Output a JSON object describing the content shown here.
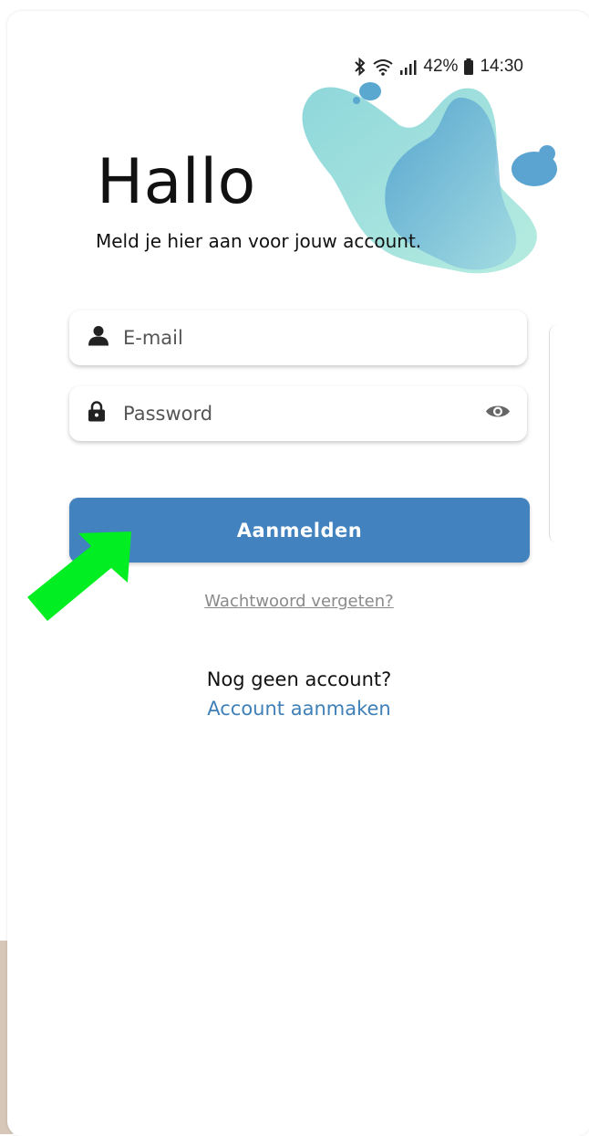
{
  "status_bar": {
    "battery": "42%",
    "time": "14:30",
    "icons": [
      "bluetooth-icon",
      "wifi-icon",
      "signal-icon",
      "battery-icon"
    ]
  },
  "header": {
    "title": "Hallo",
    "subtitle": "Meld je hier aan voor jouw account."
  },
  "form": {
    "email_placeholder": "E-mail",
    "password_placeholder": "Password",
    "submit_label": "Aanmelden"
  },
  "links": {
    "forgot_password": "Wachtwoord vergeten?",
    "no_account": "Nog geen account?",
    "create_account": "Account aanmaken"
  },
  "colors": {
    "primary": "#4282bf",
    "link": "#3f80b8",
    "annotation_arrow": "#00ee22",
    "blob_light": "#a8e6da",
    "blob_dark": "#5aa8d0"
  }
}
